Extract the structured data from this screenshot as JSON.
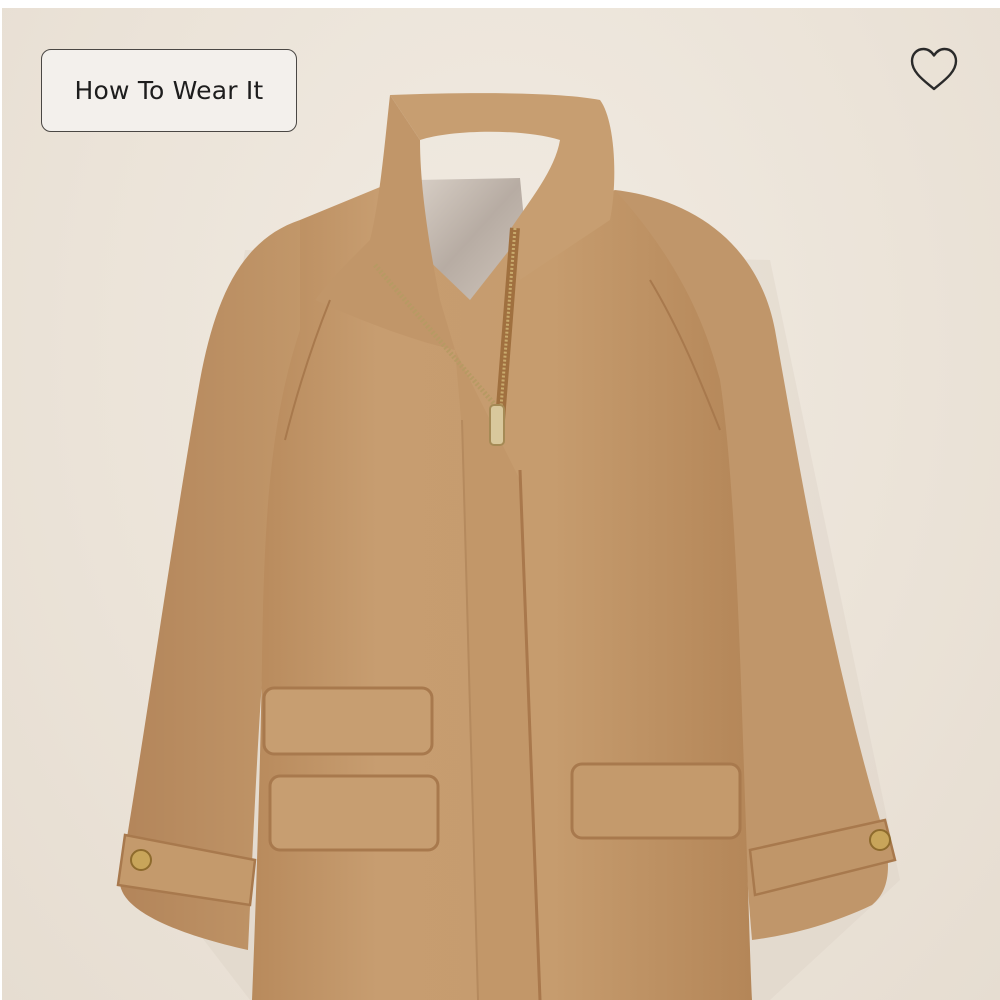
{
  "product_image": {
    "icon": "camel-wool-coat-image"
  },
  "how_to_wear": {
    "label": "How To Wear It"
  },
  "favorite": {
    "icon": "heart-outline-icon"
  },
  "colors": {
    "background": "#ece4d9",
    "coat": "#c49a6c",
    "button_border": "#4a4744",
    "button_fill": "#f3f0ec",
    "heart": "#2a2a2a"
  }
}
